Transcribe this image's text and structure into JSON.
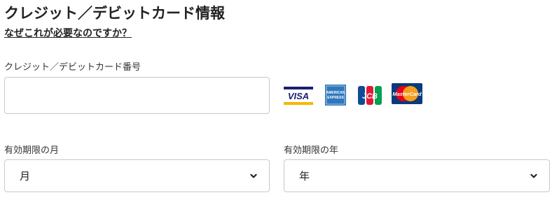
{
  "page_title": "クレジット／デビットカード情報",
  "why_link": "なぜこれが必要なのですか？",
  "card_number": {
    "label": "クレジット／デビットカード番号",
    "value": "",
    "placeholder": ""
  },
  "card_brands": {
    "visa": "VISA",
    "amex_line1": "AMERICAN",
    "amex_line2": "EXPRESS",
    "jcb": "JCB",
    "mastercard": "MasterCard"
  },
  "expiry_month": {
    "label": "有効期限の月",
    "selected": "月"
  },
  "expiry_year": {
    "label": "有効期限の年",
    "selected": "年"
  },
  "colors": {
    "visa_blue": "#1a1f71",
    "visa_gold": "#f7b600",
    "amex_blue": "#2e77bc",
    "jcb_blue": "#0e4c96",
    "jcb_red": "#e21836",
    "jcb_green": "#00a150",
    "mc_red": "#eb001b",
    "mc_orange": "#f79e1b",
    "mc_navy": "#0a3a7a"
  }
}
